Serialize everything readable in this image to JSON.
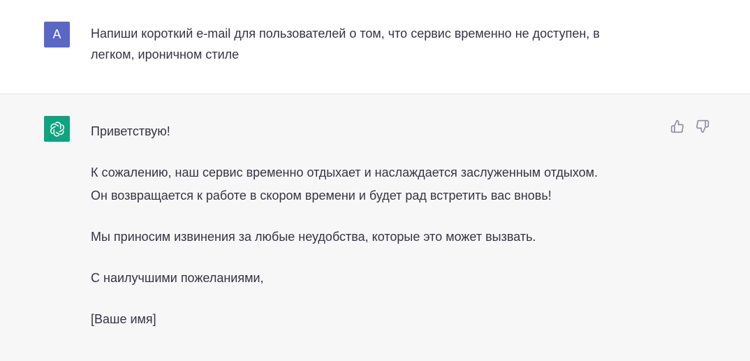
{
  "user": {
    "avatar_letter": "A",
    "avatar_color": "#5a67c4",
    "message_line1": "Напиши короткий e-mail для пользователей о том, что сервис временно не доступен, в",
    "message_line2": "легком, ироничном стиле"
  },
  "assistant": {
    "avatar_icon": "openai-logo-icon",
    "avatar_color": "#10a37f",
    "greeting": "Приветствую!",
    "body_line1": "К сожалению, наш сервис временно отдыхает и наслаждается заслуженным отдыхом.",
    "body_line2": "Он возвращается к работе в скором времени и будет рад встретить вас вновь!",
    "apology": "Мы приносим извинения за любые неудобства, которые это может вызвать.",
    "closing": "С наилучшими пожеланиями,",
    "signature": "[Ваше имя]",
    "feedback": {
      "like_icon": "thumbs-up-icon",
      "dislike_icon": "thumbs-down-icon"
    }
  }
}
